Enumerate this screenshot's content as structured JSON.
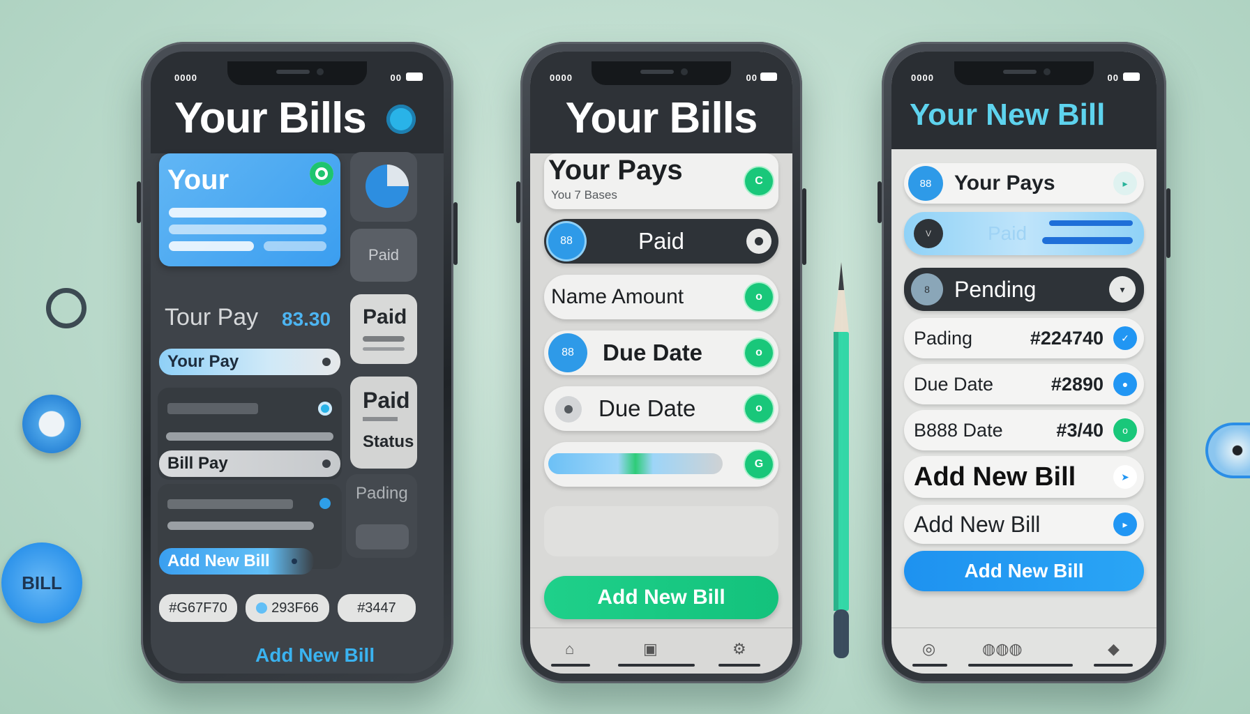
{
  "colors": {
    "accent_blue": "#2196f3",
    "accent_green": "#1dcf82",
    "dark": "#2b2f34",
    "background": "#b9d9ca"
  },
  "decor": {
    "bill_badge": "BILL"
  },
  "phone1": {
    "status_left": "0000",
    "status_right": "00",
    "title": "Your Bills",
    "card_title": "Your",
    "side_tiles": [
      "Paid",
      "Paid",
      "Paid",
      "Status",
      "Pading"
    ],
    "pay_label": "Tour Pay",
    "pay_amount": "83.30",
    "pill_your_pay": "Your Pay",
    "pill_bill_pay": "Bill Pay",
    "pill_add_new": "Add New Bill",
    "codes": [
      "#G67F70",
      "293F66",
      "#3447"
    ],
    "footer_link": "Add New Bill"
  },
  "phone2": {
    "status_left": "0000",
    "status_right": "00",
    "title": "Your Bills",
    "row1_title": "Your Pays",
    "row1_sub": "You 7 Bases",
    "row2": "Paid",
    "row3": "Name Amount",
    "row4": "Due Date",
    "row5": "Due Date",
    "button": "Add New Bill"
  },
  "phone3": {
    "status_left": "0000",
    "status_right": "00",
    "title": "Your New Bill",
    "row1": "Your Pays",
    "row2": "Paid",
    "row3": "Pending",
    "row4": "Pading",
    "row4_num": "#224740",
    "row5": "Due Date",
    "row5_num": "#2890",
    "row6": "B888 Date",
    "row6_num": "#3/40",
    "row7": "Add New Bill",
    "row8": "Add New Bill",
    "button": "Add New Bill"
  }
}
